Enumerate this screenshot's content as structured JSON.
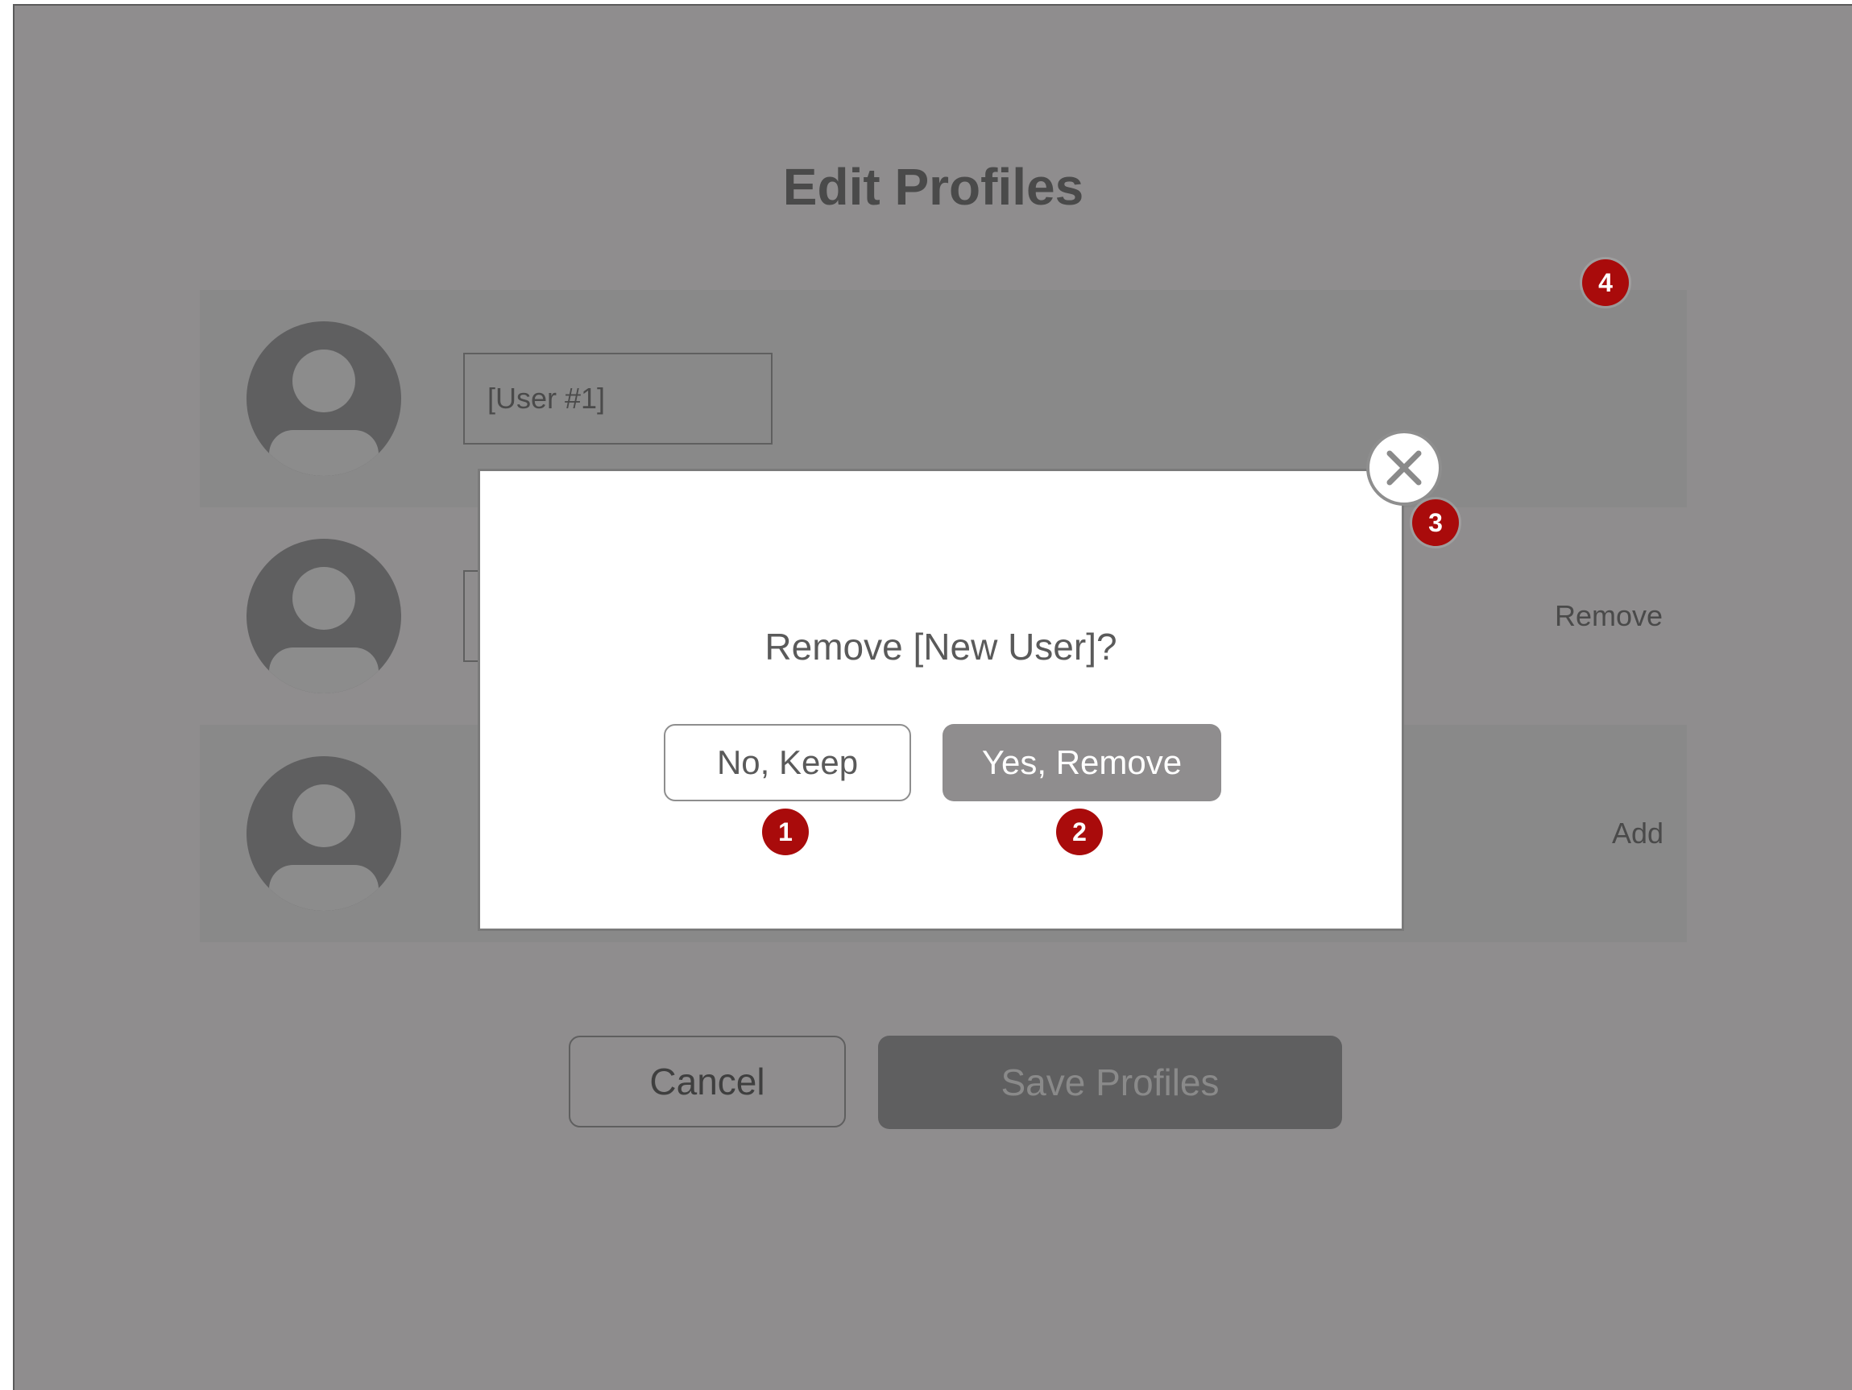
{
  "page": {
    "title": "Edit Profiles"
  },
  "profiles": [
    {
      "name": "[User #1]",
      "action": ""
    },
    {
      "name": "",
      "action": "Remove"
    },
    {
      "name": "",
      "action": "Add"
    }
  ],
  "footer": {
    "cancel_label": "Cancel",
    "save_label": "Save Profiles"
  },
  "dialog": {
    "title": "Remove [New User]?",
    "keep_label": "No, Keep",
    "remove_label": "Yes, Remove",
    "close_icon": "close-icon"
  },
  "markers": [
    "1",
    "2",
    "3",
    "4"
  ],
  "colors": {
    "overlay": "#8f8d8e",
    "row_dark": "#898989",
    "avatar": "#5f5f60",
    "marker": "#a90b0b",
    "dialog_bg": "#ffffff"
  }
}
